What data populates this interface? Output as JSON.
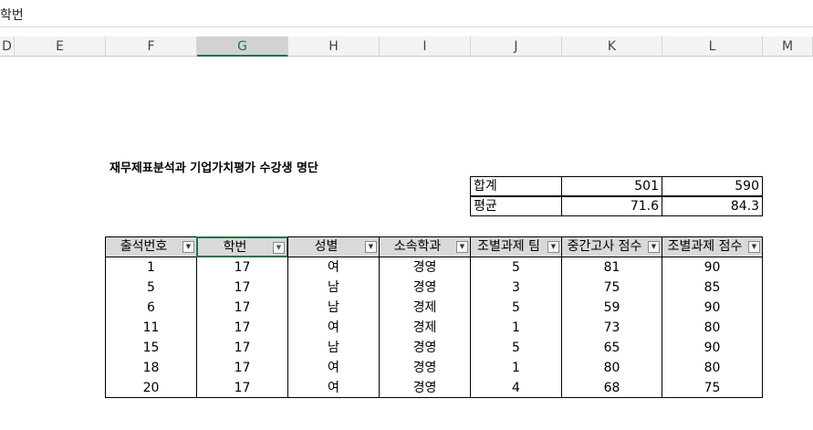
{
  "formula_bar": {
    "content": "학번"
  },
  "columns": [
    "D",
    "E",
    "F",
    "G",
    "H",
    "I",
    "J",
    "K",
    "L",
    "M"
  ],
  "selected_column": "G",
  "title": "재무제표분석과 기업가치평가 수강생 명단",
  "summary": {
    "rows": [
      {
        "label": "합계",
        "k": "501",
        "l": "590"
      },
      {
        "label": "평균",
        "k": "71.6",
        "l": "84.3"
      }
    ]
  },
  "table": {
    "headers": [
      "출석번호",
      "학번",
      "성별",
      "소속학과",
      "조별과제 팀",
      "중간고사 점수",
      "조별과제 점수"
    ],
    "active_filter_column": "학번",
    "rows": [
      [
        "1",
        "17",
        "여",
        "경영",
        "5",
        "81",
        "90"
      ],
      [
        "5",
        "17",
        "남",
        "경영",
        "3",
        "75",
        "85"
      ],
      [
        "6",
        "17",
        "남",
        "경제",
        "5",
        "59",
        "90"
      ],
      [
        "11",
        "17",
        "여",
        "경제",
        "1",
        "73",
        "80"
      ],
      [
        "15",
        "17",
        "남",
        "경영",
        "5",
        "65",
        "90"
      ],
      [
        "18",
        "17",
        "여",
        "경영",
        "1",
        "80",
        "80"
      ],
      [
        "20",
        "17",
        "여",
        "경영",
        "4",
        "68",
        "75"
      ]
    ]
  },
  "colors": {
    "accent": "#217346",
    "header_fill": "#d9d9d9"
  }
}
